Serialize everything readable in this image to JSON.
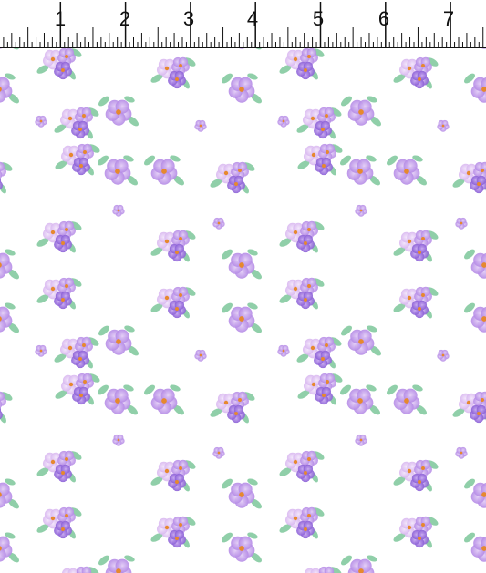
{
  "ruler": {
    "numbers": [
      "1",
      "2",
      "3",
      "4",
      "5",
      "6",
      "7"
    ]
  },
  "fabric": {
    "description_colors": {
      "background": "#ffffff",
      "petal_light": "#d9b8f0",
      "petal_mid": "#b58be6",
      "petal_dark": "#8a5fd6",
      "center": "#e6892e",
      "leaf": "#7cc79a"
    }
  }
}
